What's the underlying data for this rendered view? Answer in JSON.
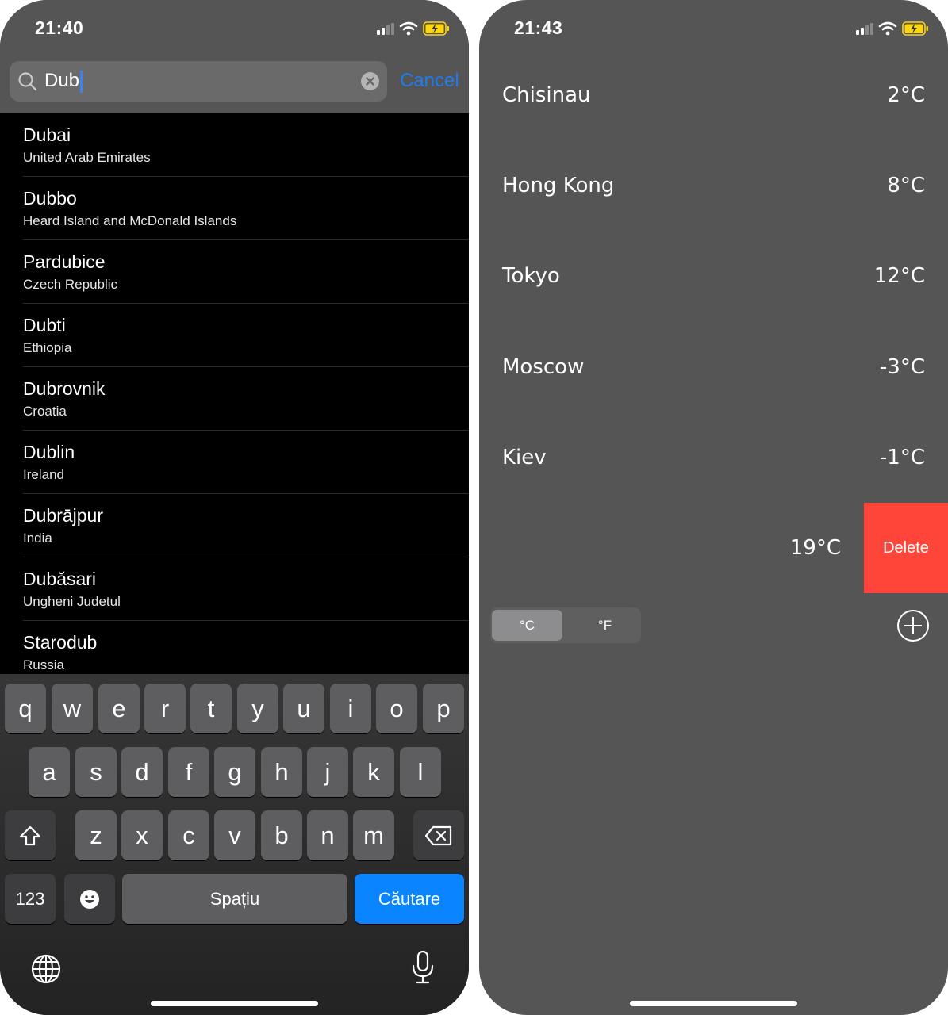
{
  "left": {
    "status": {
      "time": "21:40"
    },
    "search": {
      "value": "Dub",
      "cancel_label": "Cancel"
    },
    "results": [
      {
        "name": "Dubai",
        "country": "United Arab Emirates"
      },
      {
        "name": "Dubbo",
        "country": "Heard Island and McDonald Islands"
      },
      {
        "name": "Pardubice",
        "country": "Czech Republic"
      },
      {
        "name": "Dubti",
        "country": "Ethiopia"
      },
      {
        "name": "Dubrovnik",
        "country": "Croatia"
      },
      {
        "name": "Dublin",
        "country": "Ireland"
      },
      {
        "name": "Dubrājpur",
        "country": "India"
      },
      {
        "name": "Dubăsari",
        "country": "Ungheni Judetul"
      },
      {
        "name": "Starodub",
        "country": "Russia"
      }
    ],
    "keyboard": {
      "row1": [
        "q",
        "w",
        "e",
        "r",
        "t",
        "y",
        "u",
        "i",
        "o",
        "p"
      ],
      "row2": [
        "a",
        "s",
        "d",
        "f",
        "g",
        "h",
        "j",
        "k",
        "l"
      ],
      "row3": [
        "z",
        "x",
        "c",
        "v",
        "b",
        "n",
        "m"
      ],
      "numbers_label": "123",
      "space_label": "Spațiu",
      "search_label": "Căutare"
    }
  },
  "right": {
    "status": {
      "time": "21:43"
    },
    "cities": [
      {
        "name": "Chisinau",
        "temp": "2°C"
      },
      {
        "name": "Hong Kong",
        "temp": "8°C"
      },
      {
        "name": "Tokyo",
        "temp": "12°C"
      },
      {
        "name": "Moscow",
        "temp": "-3°C"
      },
      {
        "name": "Kiev",
        "temp": "-1°C"
      }
    ],
    "swiped_row": {
      "temp": "19°C",
      "delete_label": "Delete"
    },
    "units": {
      "celsius": "°C",
      "fahrenheit": "°F",
      "selected": "celsius"
    }
  },
  "colors": {
    "accent": "#0a84ff",
    "delete": "#ff453a",
    "battery": "#ffd60a"
  },
  "icons": [
    "search-icon",
    "clear-icon",
    "shift-icon",
    "backspace-icon",
    "emoji-icon",
    "globe-icon",
    "microphone-icon",
    "plus-circle-icon",
    "wifi-icon",
    "battery-charging-icon",
    "signal-icon"
  ]
}
